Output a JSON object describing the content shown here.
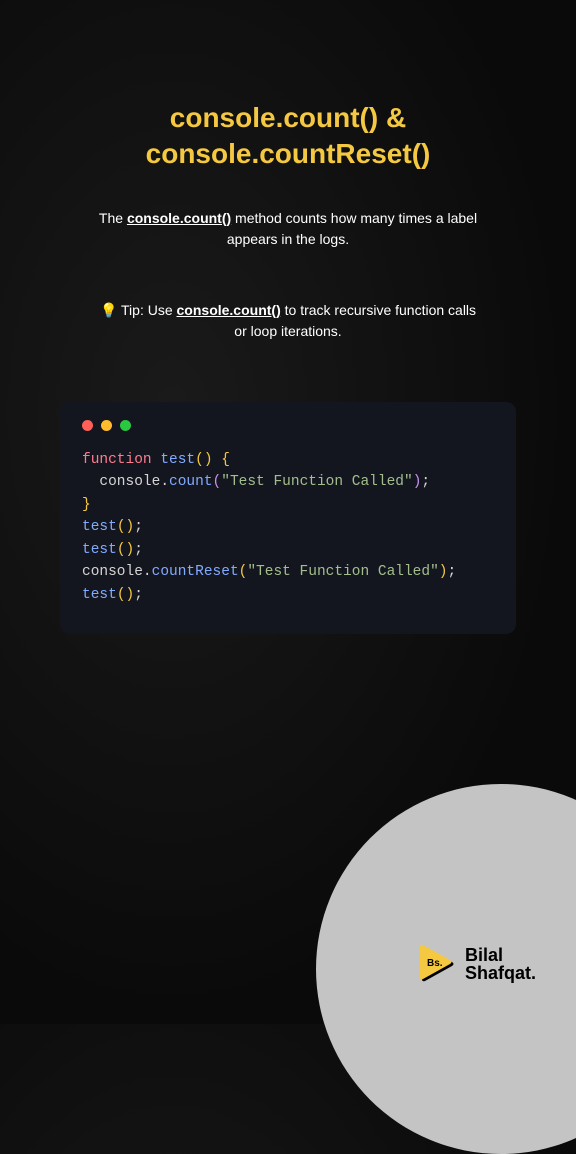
{
  "title": "console.count() & console.countReset()",
  "description": {
    "prefix": "The ",
    "highlight": "console.count()",
    "suffix": " method counts how many times a label appears in the logs."
  },
  "tip": {
    "bulb": "💡",
    "prefix": " Tip: Use ",
    "highlight": "console.count()",
    "suffix": " to track recursive function calls or loop iterations."
  },
  "code": {
    "line1_keyword": "function",
    "line1_name": " test",
    "line1_paren": "()",
    "line1_brace": " {",
    "line2_indent": "  ",
    "line2_obj": "console",
    "line2_dot": ".",
    "line2_method": "count",
    "line2_paren_open": "(",
    "line2_string": "\"Test Function Called\"",
    "line2_paren_close": ")",
    "line2_semi": ";",
    "line3_brace": "}",
    "line4_call": "test",
    "line4_paren": "()",
    "line4_semi": ";",
    "line5_call": "test",
    "line5_paren": "()",
    "line5_semi": ";",
    "line6_obj": "console",
    "line6_dot": ".",
    "line6_method": "countReset",
    "line6_paren_open": "(",
    "line6_string": "\"Test Function Called\"",
    "line6_paren_close": ")",
    "line6_semi": ";",
    "line7_call": "test",
    "line7_paren": "()",
    "line7_semi": ";"
  },
  "author": {
    "badge": "Bs.",
    "first": "Bilal",
    "last": "Shafqat."
  },
  "colors": {
    "accent": "#f5c842",
    "background": "#0a0a0a",
    "code_bg": "#14161f"
  }
}
